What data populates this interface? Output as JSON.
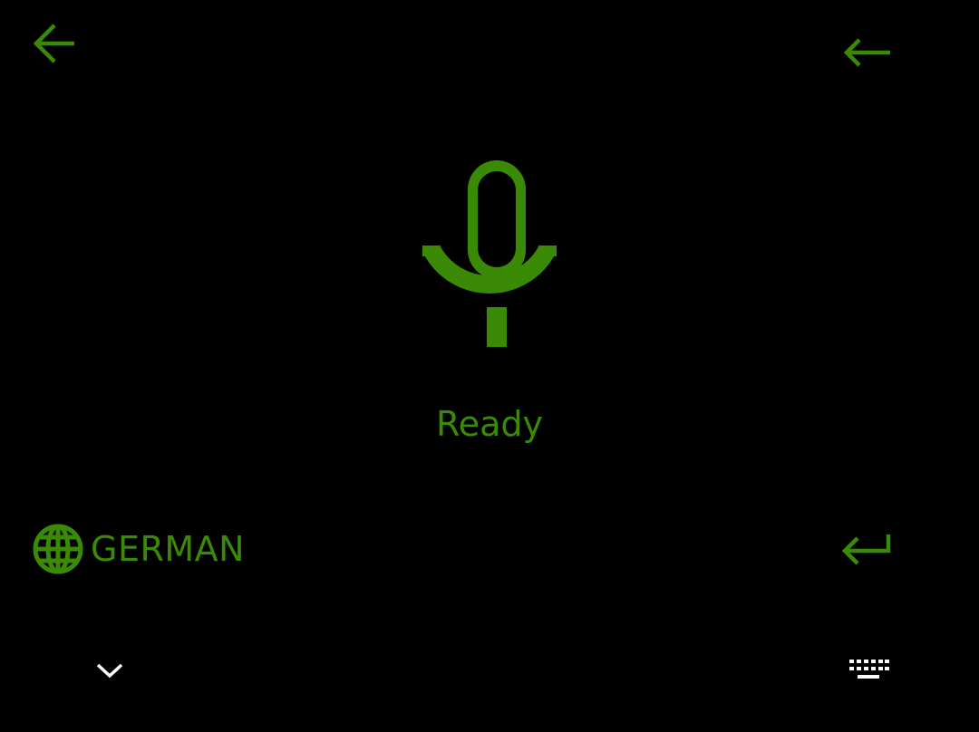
{
  "colors": {
    "accent": "#3a8a05",
    "background": "#000000",
    "nav_icon": "#ffffff"
  },
  "top_bar": {
    "back_icon": "arrow-left-icon",
    "backspace_icon": "backspace-arrow-icon"
  },
  "voice": {
    "mic_icon": "microphone-icon",
    "status": "Ready"
  },
  "language": {
    "icon": "globe-icon",
    "label": "GERMAN"
  },
  "actions": {
    "enter_icon": "enter-return-icon"
  },
  "nav_bar": {
    "hide_icon": "chevron-down-icon",
    "keyboard_icon": "keyboard-icon"
  }
}
